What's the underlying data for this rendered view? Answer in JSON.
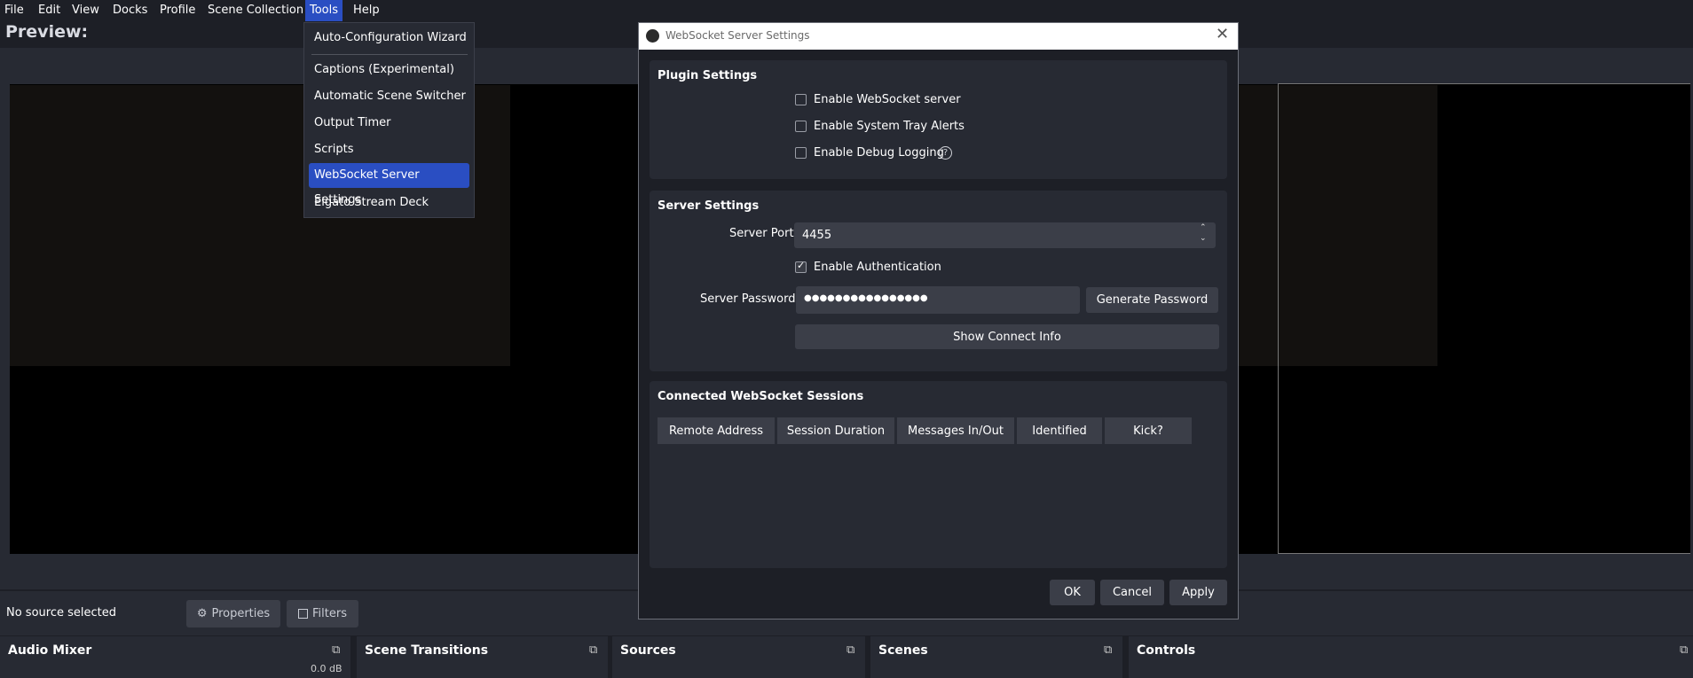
{
  "menubar": {
    "items": [
      "File",
      "Edit",
      "View",
      "Docks",
      "Profile",
      "Scene Collection",
      "Tools",
      "Help"
    ]
  },
  "preview": {
    "label": "Preview:"
  },
  "status": {
    "no_source": "No source selected",
    "properties_label": "Properties",
    "filters_label": "Filters"
  },
  "docks": {
    "audio_mixer": "Audio Mixer",
    "scene_transitions": "Scene Transitions",
    "sources": "Sources",
    "scenes": "Scenes",
    "controls": "Controls"
  },
  "tools_menu": {
    "items": [
      "Auto-Configuration Wizard",
      "Captions (Experimental)",
      "Automatic Scene Switcher",
      "Output Timer",
      "Scripts",
      "WebSocket Server Settings",
      "Elgato Stream Deck"
    ],
    "selected": "WebSocket Server Settings"
  },
  "dialog": {
    "title": "WebSocket Server Settings",
    "close_glyph": "✕",
    "plugin_settings": {
      "title": "Plugin Settings",
      "enable_server": {
        "label": "Enable WebSocket server",
        "checked": false
      },
      "tray_alerts": {
        "label": "Enable System Tray Alerts",
        "checked": false
      },
      "debug_logging": {
        "label": "Enable Debug Logging",
        "checked": false
      }
    },
    "server_settings": {
      "title": "Server Settings",
      "port_label": "Server Port",
      "port_value": "4455",
      "auth_label": "Enable Authentication",
      "auth_checked": true,
      "password_label": "Server Password",
      "password_value": "●●●●●●●●●●●●●●●●",
      "generate_label": "Generate Password",
      "connect_info_label": "Show Connect Info"
    },
    "sessions": {
      "title": "Connected WebSocket Sessions",
      "columns": [
        "Remote Address",
        "Session Duration",
        "Messages In/Out",
        "Identified",
        "Kick?"
      ]
    },
    "buttons": {
      "ok": "OK",
      "cancel": "Cancel",
      "apply": "Apply"
    }
  },
  "colors": {
    "accent": "#2a4ec2",
    "background": "#1d1f26",
    "panel": "#272a33",
    "control": "#3b3e48"
  }
}
